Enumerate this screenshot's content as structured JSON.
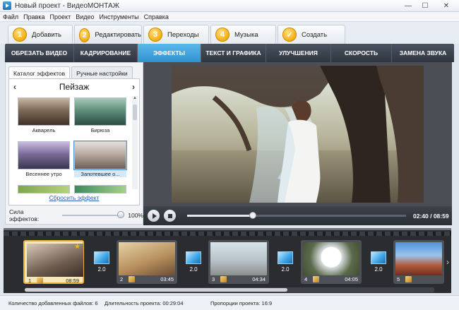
{
  "window": {
    "title": "Новый проект - ВидеоМОНТАЖ"
  },
  "menu": [
    "Файл",
    "Правка",
    "Проект",
    "Видео",
    "Инструменты",
    "Справка"
  ],
  "steps": [
    {
      "num": "1",
      "label": "Добавить"
    },
    {
      "num": "2",
      "label": "Редактировать"
    },
    {
      "num": "3",
      "label": "Переходы"
    },
    {
      "num": "4",
      "label": "Музыка"
    },
    {
      "num": "✓",
      "label": "Создать"
    }
  ],
  "subnav": [
    "ОБРЕЗАТЬ ВИДЕО",
    "КАДРИРОВАНИЕ",
    "ЭФФЕКТЫ",
    "ТЕКСТ И ГРАФИКА",
    "УЛУЧШЕНИЯ",
    "СКОРОСТЬ",
    "ЗАМЕНА ЗВУКА"
  ],
  "effects": {
    "tabs": [
      "Каталог эффектов",
      "Ручные настройки"
    ],
    "category": "Пейзаж",
    "items": [
      "Акварель",
      "Бирюза",
      "Весеннее утро",
      "Запотевшее о..."
    ],
    "reset": "Сбросить эффект",
    "strength_label": "Сила эффектов:",
    "strength_value": "100%"
  },
  "player": {
    "timecode": "02:40 / 08:59",
    "progress": 0.3
  },
  "timeline": {
    "clips": [
      {
        "n": "1",
        "dur": "08:59"
      },
      {
        "n": "2",
        "dur": "03:45"
      },
      {
        "n": "3",
        "dur": "04:34"
      },
      {
        "n": "4",
        "dur": "04:05"
      },
      {
        "n": "5",
        "dur": ""
      }
    ],
    "transitions": [
      "2.0",
      "2.0",
      "2.0",
      "2.0"
    ]
  },
  "status": {
    "files": "Количество добавленных файлов: 6",
    "duration": "Длительность проекта: 00:29:04",
    "ratio": "Пропорции проекта: 16:9"
  },
  "icons": {
    "step_active_color": "#f2a90e",
    "accent_color": "#2f93d1"
  }
}
